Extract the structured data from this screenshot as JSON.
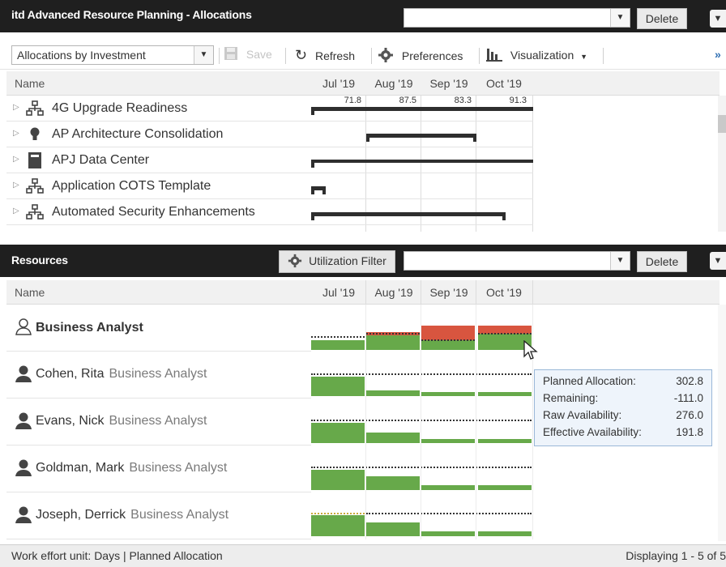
{
  "allocations_panel": {
    "title": "itd Advanced Resource Planning - Allocations",
    "filter_value": "",
    "delete_label": "Delete"
  },
  "toolbar": {
    "view_select": "Allocations by Investment",
    "save_label": "Save",
    "refresh_label": "Refresh",
    "preferences_label": "Preferences",
    "visualization_label": "Visualization",
    "overflow_label": "»"
  },
  "columns": {
    "name": "Name",
    "months": [
      "Jul '19",
      "Aug '19",
      "Sep '19",
      "Oct '19"
    ]
  },
  "totals": [
    "71.8",
    "87.5",
    "83.3",
    "91.3"
  ],
  "investments": [
    {
      "label": "4G Upgrade Readiness",
      "icon": "hierarchy-icon"
    },
    {
      "label": "AP Architecture Consolidation",
      "icon": "lightbulb-icon"
    },
    {
      "label": "APJ Data Center",
      "icon": "server-icon"
    },
    {
      "label": "Application COTS Template",
      "icon": "hierarchy-icon"
    },
    {
      "label": "Automated Security Enhancements",
      "icon": "hierarchy-icon"
    }
  ],
  "resources_panel": {
    "title": "Resources",
    "utilization_filter_label": "Utilization Filter",
    "filter_value": "",
    "delete_label": "Delete"
  },
  "resources": [
    {
      "name": "Business Analyst",
      "role": "",
      "icon": "role-outline-icon"
    },
    {
      "name": "Cohen, Rita",
      "role": "Business Analyst",
      "icon": "person-icon"
    },
    {
      "name": "Evans, Nick",
      "role": "Business Analyst",
      "icon": "person-icon"
    },
    {
      "name": "Goldman, Mark",
      "role": "Business Analyst",
      "icon": "person-icon"
    },
    {
      "name": "Joseph, Derrick",
      "role": "Business Analyst",
      "icon": "person-icon"
    }
  ],
  "tooltip": {
    "rows": [
      {
        "label": "Planned Allocation:",
        "value": "302.8"
      },
      {
        "label": "Remaining:",
        "value": "-111.0"
      },
      {
        "label": "Raw Availability:",
        "value": "276.0"
      },
      {
        "label": "Effective Availability:",
        "value": "191.8"
      }
    ]
  },
  "status_bar": {
    "left": "Work effort unit: Days | Planned Allocation",
    "right": "Displaying 1 - 5 of 5"
  },
  "colors": {
    "header_bg": "#1f1f1f",
    "capacity_green": "#67a94a",
    "overallocation_red": "#d8553f",
    "gantt_bar": "#2e2e2e",
    "tooltip_bg": "#eef4fb"
  }
}
